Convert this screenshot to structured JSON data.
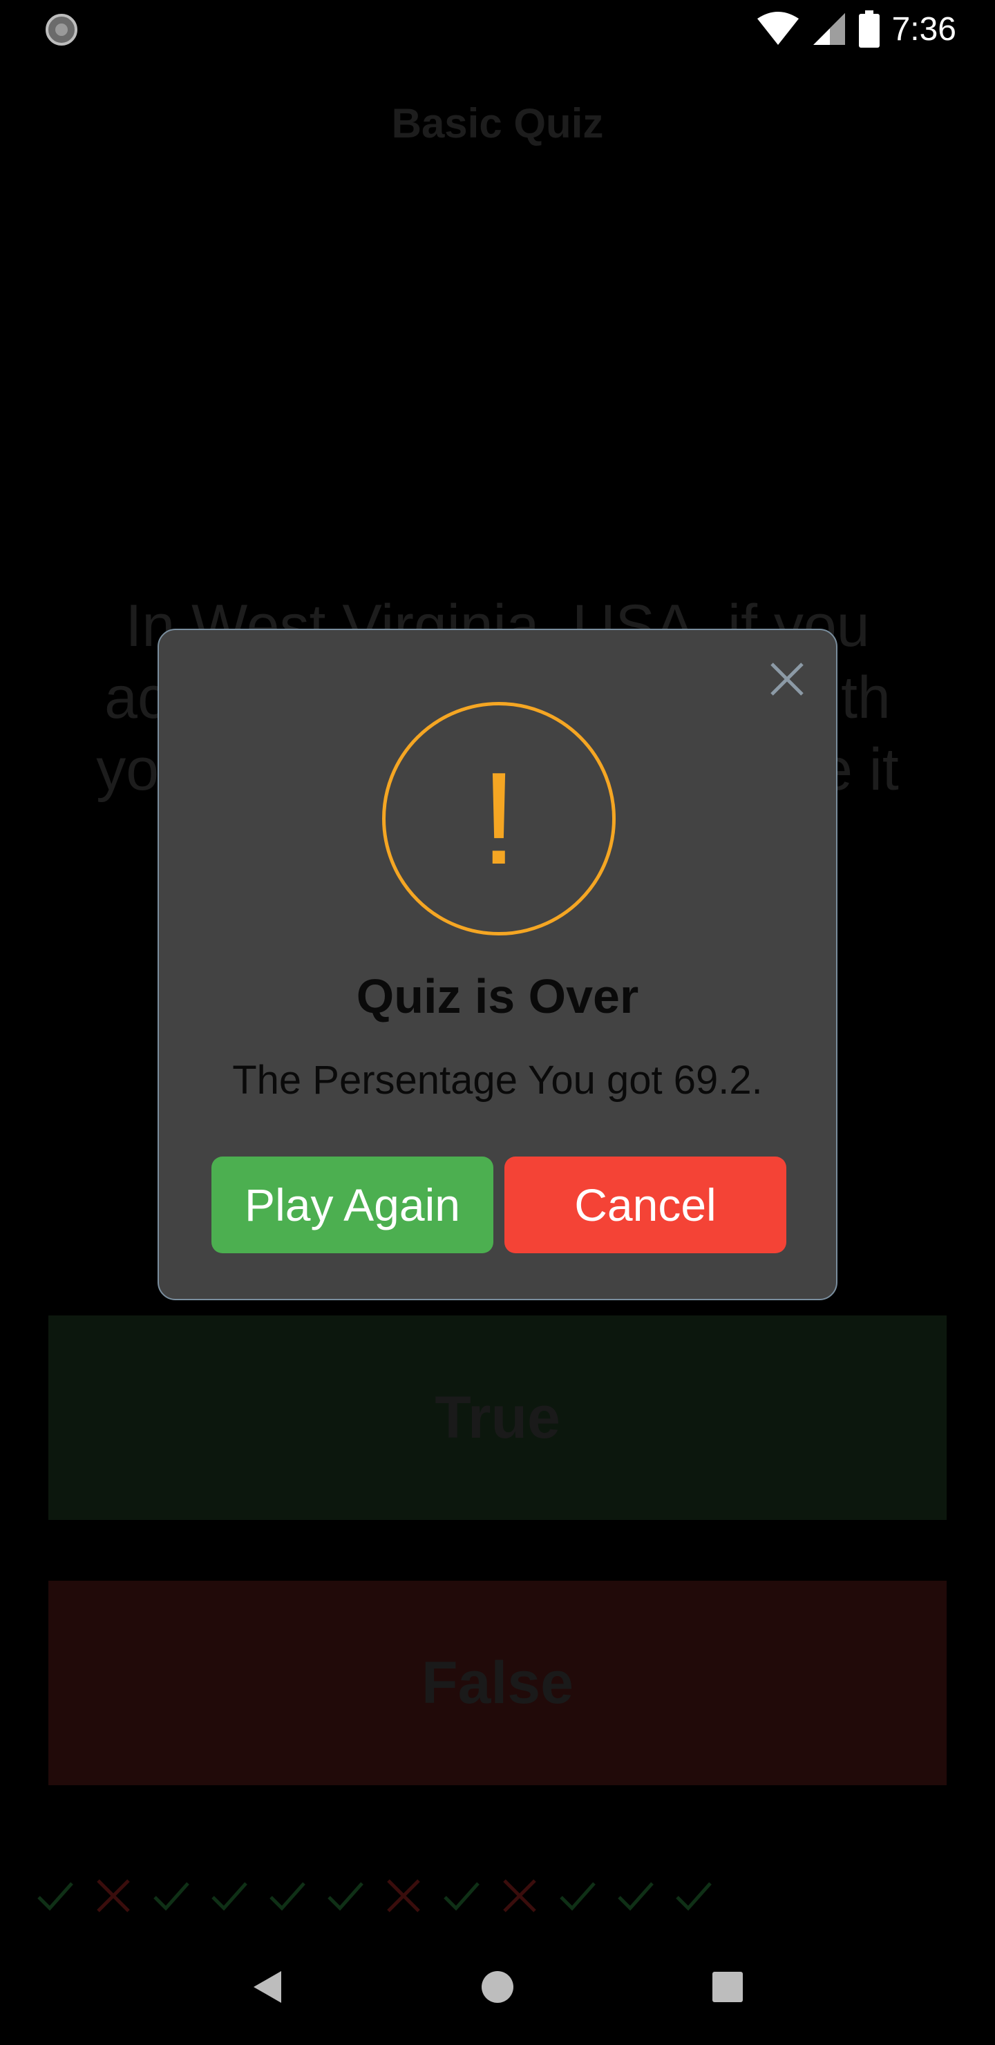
{
  "status_bar": {
    "time": "7:36",
    "icons": [
      "sync-icon",
      "wifi-icon",
      "signal-icon",
      "battery-icon"
    ]
  },
  "app": {
    "title": "Basic Quiz",
    "question": "In West Virginia, USA, if you accidentally hit an animal with your car, you are free to take it",
    "true_label": "True",
    "false_label": "False",
    "score_marks": [
      "check",
      "cross",
      "check",
      "check",
      "check",
      "check",
      "cross",
      "check",
      "cross",
      "check",
      "check",
      "check"
    ]
  },
  "dialog": {
    "icon": "warning-icon",
    "title": "Quiz is Over",
    "message": "The Persentage You got  69.2.",
    "play_again_label": "Play Again",
    "cancel_label": "Cancel",
    "close_icon": "close-icon"
  },
  "nav_bar": {
    "buttons": [
      "back-icon",
      "home-icon",
      "recents-icon"
    ]
  },
  "colors": {
    "dialog_bg": "#434343",
    "accent_warning": "#f5a623",
    "play_again": "#4caf50",
    "cancel": "#f44336",
    "check_dim": "#0f3016",
    "cross_dim": "#3a0d0c"
  }
}
